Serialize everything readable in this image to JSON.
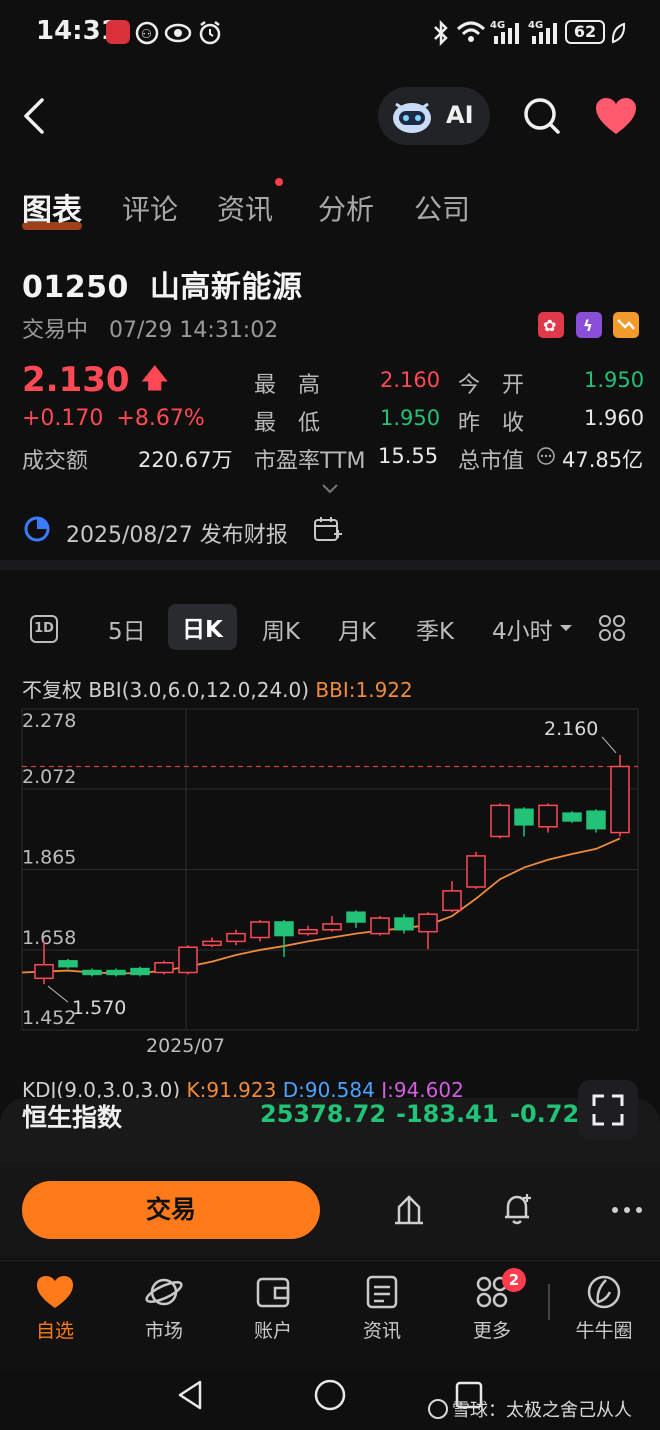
{
  "status_bar": {
    "time": "14:31",
    "battery": "62"
  },
  "header": {
    "ai_label": "AI"
  },
  "tabs": [
    {
      "label": "图表",
      "active": true
    },
    {
      "label": "评论",
      "active": false
    },
    {
      "label": "资讯",
      "active": false,
      "dot": true
    },
    {
      "label": "分析",
      "active": false
    },
    {
      "label": "公司",
      "active": false
    }
  ],
  "stock": {
    "code": "01250",
    "name": "山高新能源",
    "status": "交易中",
    "datetime": "07/29 14:31:02",
    "price": "2.130",
    "change": "+0.170",
    "change_pct": "+8.67%",
    "turnover_label": "成交额",
    "turnover": "220.67万",
    "high_label": "最　高",
    "high": "2.160",
    "low_label": "最　低",
    "low": "1.950",
    "pe_label": "市盈率TTM",
    "pe": "15.55",
    "open_label": "今　开",
    "open": "1.950",
    "prev_close_label": "昨　收",
    "prev_close": "1.960",
    "mcap_label": "总市值",
    "mcap": "47.85亿"
  },
  "earnings": {
    "text": "2025/08/27 发布财报"
  },
  "periods": [
    "5日",
    "日K",
    "周K",
    "月K",
    "季K",
    "4小时"
  ],
  "period_1d_icon": "1D",
  "indicator": {
    "prefix": "不复权 BBI(3.0,6.0,12.0,24.0)",
    "bbi": "BBI:1.922"
  },
  "chart_data": {
    "type": "candlestick",
    "y_ticks": [
      "2.278",
      "2.072",
      "1.865",
      "1.658",
      "1.452"
    ],
    "ylim": [
      1.452,
      2.278
    ],
    "x_label": "2025/07",
    "high_marker": "2.160",
    "low_marker": "1.570",
    "reference_line": 2.13,
    "candles": [
      {
        "o": 1.585,
        "c": 1.62,
        "h": 1.68,
        "l": 1.57,
        "up": true
      },
      {
        "o": 1.63,
        "c": 1.615,
        "h": 1.635,
        "l": 1.61,
        "up": false
      },
      {
        "o": 1.605,
        "c": 1.595,
        "h": 1.61,
        "l": 1.59,
        "up": false
      },
      {
        "o": 1.605,
        "c": 1.595,
        "h": 1.61,
        "l": 1.59,
        "up": false
      },
      {
        "o": 1.61,
        "c": 1.595,
        "h": 1.615,
        "l": 1.59,
        "up": false
      },
      {
        "o": 1.6,
        "c": 1.625,
        "h": 1.63,
        "l": 1.595,
        "up": true
      },
      {
        "o": 1.6,
        "c": 1.665,
        "h": 1.67,
        "l": 1.595,
        "up": true
      },
      {
        "o": 1.67,
        "c": 1.68,
        "h": 1.69,
        "l": 1.665,
        "up": true
      },
      {
        "o": 1.68,
        "c": 1.7,
        "h": 1.71,
        "l": 1.67,
        "up": true
      },
      {
        "o": 1.69,
        "c": 1.73,
        "h": 1.735,
        "l": 1.68,
        "up": true
      },
      {
        "o": 1.73,
        "c": 1.695,
        "h": 1.735,
        "l": 1.64,
        "up": false
      },
      {
        "o": 1.7,
        "c": 1.71,
        "h": 1.72,
        "l": 1.695,
        "up": true
      },
      {
        "o": 1.71,
        "c": 1.725,
        "h": 1.745,
        "l": 1.705,
        "up": true
      },
      {
        "o": 1.755,
        "c": 1.73,
        "h": 1.76,
        "l": 1.715,
        "up": false
      },
      {
        "o": 1.7,
        "c": 1.74,
        "h": 1.745,
        "l": 1.695,
        "up": true
      },
      {
        "o": 1.74,
        "c": 1.71,
        "h": 1.75,
        "l": 1.7,
        "up": false
      },
      {
        "o": 1.705,
        "c": 1.75,
        "h": 1.755,
        "l": 1.66,
        "up": true
      },
      {
        "o": 1.76,
        "c": 1.81,
        "h": 1.835,
        "l": 1.755,
        "up": true
      },
      {
        "o": 1.82,
        "c": 1.9,
        "h": 1.91,
        "l": 1.815,
        "up": true
      },
      {
        "o": 1.95,
        "c": 2.03,
        "h": 2.035,
        "l": 1.945,
        "up": true
      },
      {
        "o": 2.02,
        "c": 1.98,
        "h": 2.025,
        "l": 1.95,
        "up": false
      },
      {
        "o": 1.975,
        "c": 2.03,
        "h": 2.035,
        "l": 1.96,
        "up": true
      },
      {
        "o": 2.01,
        "c": 1.99,
        "h": 2.015,
        "l": 1.985,
        "up": false
      },
      {
        "o": 2.015,
        "c": 1.97,
        "h": 2.02,
        "l": 1.96,
        "up": false
      },
      {
        "o": 1.96,
        "c": 2.13,
        "h": 2.16,
        "l": 1.95,
        "up": true
      }
    ],
    "bbi": [
      1.6,
      1.605,
      1.6,
      1.598,
      1.598,
      1.605,
      1.615,
      1.628,
      1.645,
      1.658,
      1.668,
      1.68,
      1.69,
      1.7,
      1.708,
      1.714,
      1.722,
      1.745,
      1.79,
      1.84,
      1.87,
      1.89,
      1.905,
      1.918,
      1.945
    ]
  },
  "kdj": {
    "prefix": "KDJ(9.0,3.0,3.0)",
    "k": "K:91.923",
    "d": "D:90.584",
    "j": "J:94.602"
  },
  "index_ticker": {
    "name": "恒生指数",
    "value": "25378.72",
    "change": "-183.41",
    "change_pct": "-0.72%"
  },
  "actions": {
    "trade_label": "交易"
  },
  "nav": [
    {
      "label": "自选",
      "icon": "heart-icon",
      "active": true
    },
    {
      "label": "市场",
      "icon": "planet-icon",
      "active": false
    },
    {
      "label": "账户",
      "icon": "wallet-icon",
      "active": false
    },
    {
      "label": "资讯",
      "icon": "news-icon",
      "active": false
    },
    {
      "label": "更多",
      "icon": "grid-icon",
      "active": false,
      "badge": "2"
    },
    {
      "label": "牛牛圈",
      "icon": "niuniu-icon",
      "active": false
    }
  ],
  "watermark": "雪球：太极之舍己从人",
  "colors": {
    "up": "#ff4a55",
    "down": "#22c277",
    "accent": "#ff7a1a",
    "bbi": "#f08a3c"
  }
}
